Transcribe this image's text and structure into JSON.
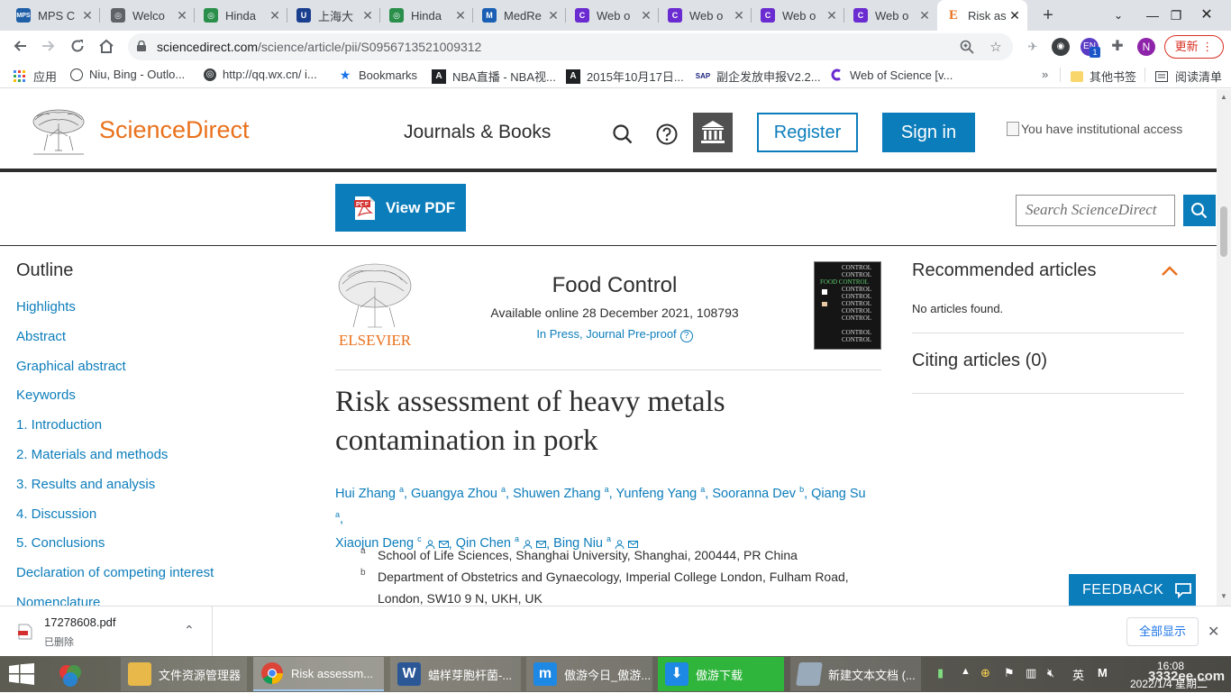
{
  "browser": {
    "tabs": [
      {
        "label": "MPS C",
        "fav_color": "#1f5fa8",
        "fav_text": "MPS"
      },
      {
        "label": "Welco",
        "fav_color": "#5f6368",
        "fav_text": "◎"
      },
      {
        "label": "Hinda",
        "fav_color": "#2a8f4a",
        "fav_text": "◎"
      },
      {
        "label": "上海大",
        "fav_color": "#1b3f8f",
        "fav_text": "U"
      },
      {
        "label": "Hinda",
        "fav_color": "#2a8f4a",
        "fav_text": "◎"
      },
      {
        "label": "MedRe",
        "fav_color": "#1a5fb4",
        "fav_text": "M"
      },
      {
        "label": "Web o",
        "fav_color": "#6a2bd0",
        "fav_text": "C"
      },
      {
        "label": "Web o",
        "fav_color": "#6a2bd0",
        "fav_text": "C"
      },
      {
        "label": "Web o",
        "fav_color": "#6a2bd0",
        "fav_text": "C"
      },
      {
        "label": "Web o",
        "fav_color": "#6a2bd0",
        "fav_text": "C"
      },
      {
        "label": "Risk as",
        "fav_color": "#e9711c",
        "fav_text": "E"
      }
    ],
    "url_host": "sciencedirect.com",
    "url_path": "/science/article/pii/S0956713521009312",
    "update_label": "更新",
    "profile_initial": "N",
    "ext_badge": "1"
  },
  "bookmarks": [
    {
      "label": "应用",
      "icon": "apps-grid-icon"
    },
    {
      "label": "Niu, Bing - Outlo...",
      "icon": "outlook-icon"
    },
    {
      "label": "http://qq.wx.cn/ i...",
      "icon": "globe-icon"
    },
    {
      "label": "Bookmarks",
      "icon": "star-icon"
    },
    {
      "label": "NBA直播 - NBA视...",
      "icon": "nba-icon"
    },
    {
      "label": "2015年10月17日...",
      "icon": "nba-icon"
    },
    {
      "label": "副企发放申报V2.2...",
      "icon": "report-icon"
    },
    {
      "label": "Web of Science [v...",
      "icon": "wos-icon"
    },
    {
      "label": "其他书签",
      "icon": "folder-icon"
    },
    {
      "label": "阅读清单",
      "icon": "reading-list-icon"
    }
  ],
  "site": {
    "logo_text": "ScienceDirect",
    "nav_journals": "Journals & Books",
    "register": "Register",
    "sign_in": "Sign in",
    "inst_access": "You have institutional access",
    "view_pdf": "View PDF",
    "search_placeholder": "Search ScienceDirect"
  },
  "outline": {
    "title": "Outline",
    "items": [
      "Highlights",
      "Abstract",
      "Graphical abstract",
      "Keywords",
      "1. Introduction",
      "2. Materials and methods",
      "3. Results and analysis",
      "4. Discussion",
      "5. Conclusions",
      "Declaration of competing interest",
      "Nomenclature"
    ]
  },
  "article": {
    "journal": "Food Control",
    "available": "Available online 28 December 2021, 108793",
    "in_press": "In Press, Journal Pre-proof",
    "elsevier": "ELSEVIER",
    "title_line1": "Risk assessment of heavy metals",
    "title_line2": "contamination in pork",
    "authors": [
      {
        "name": "Hui Zhang",
        "aff": "a",
        "contact": false
      },
      {
        "name": "Guangya Zhou",
        "aff": "a",
        "contact": false
      },
      {
        "name": "Shuwen Zhang",
        "aff": "a",
        "contact": false
      },
      {
        "name": "Yunfeng Yang",
        "aff": "a",
        "contact": false
      },
      {
        "name": "Sooranna Dev",
        "aff": "b",
        "contact": false
      },
      {
        "name": "Qiang Su",
        "aff": "a",
        "contact": false
      },
      {
        "name": "Xiaojun Deng",
        "aff": "c",
        "contact": true
      },
      {
        "name": "Qin Chen",
        "aff": "a",
        "contact": true
      },
      {
        "name": "Bing Niu",
        "aff": "a",
        "contact": true
      }
    ],
    "affiliations": [
      {
        "label": "a",
        "text": "School of Life Sciences, Shanghai University, Shanghai, 200444, PR China"
      },
      {
        "label": "b",
        "text": "Department of Obstetrics and Gynaecology, Imperial College London, Fulham Road, London, SW10 9 N, UKH, UK"
      }
    ]
  },
  "right": {
    "recommended_title": "Recommended articles",
    "no_articles": "No articles found.",
    "citing_title": "Citing articles (0)"
  },
  "feedback": "FEEDBACK",
  "downloads": {
    "file_name": "17278608.pdf",
    "status": "已删除",
    "show_all": "全部显示"
  },
  "taskbar": {
    "apps": [
      {
        "label": "文件资源管理器",
        "icon_color": "#e8b84a"
      },
      {
        "label": "Risk assessm...",
        "icon_color": "#4285f4"
      },
      {
        "label": "蜡样芽胞杆菌-...",
        "icon_color": "#2b5797"
      },
      {
        "label": "傲游今日_傲游...",
        "icon_color": "#1e88e5"
      },
      {
        "label": "傲游下载",
        "icon_color": "#1e88e5"
      },
      {
        "label": "新建文本文档 (...",
        "icon_color": "#9ab"
      }
    ],
    "ime": "英",
    "ime2": "M",
    "time": "16:08",
    "date": "2022/1/4 星期二",
    "watermark": "3332ee.com"
  }
}
